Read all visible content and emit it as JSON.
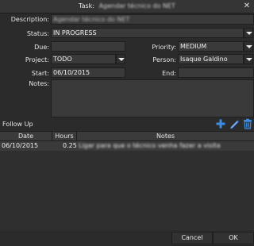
{
  "window": {
    "title_prefix": "Task:",
    "title_rest": "Agendar técnico do NET"
  },
  "form": {
    "description_label": "Description:",
    "description_value": "Agendar técnico do NET",
    "status_label": "Status:",
    "status_value": "IN PROGRESS",
    "due_label": "Due:",
    "due_value": "",
    "priority_label": "Priority:",
    "priority_value": "MEDIUM",
    "project_label": "Project:",
    "project_value": "TODO",
    "person_label": "Person:",
    "person_value": "Isaque Galdino",
    "start_label": "Start:",
    "start_value": "06/10/2015",
    "end_label": "End:",
    "end_value": "",
    "notes_label": "Notes:"
  },
  "followup": {
    "label": "Follow Up",
    "columns": [
      "Date",
      "Hours",
      "Notes"
    ],
    "rows": [
      {
        "date": "06/10/2015",
        "hours": "0.25",
        "notes": "Ligar para que o técnico venha fazer a visita"
      }
    ]
  },
  "buttons": {
    "cancel": "Cancel",
    "ok": "OK"
  },
  "icons": [
    "add-icon",
    "edit-icon",
    "delete-icon",
    "close-icon",
    "dropdown-arrow-icon"
  ]
}
